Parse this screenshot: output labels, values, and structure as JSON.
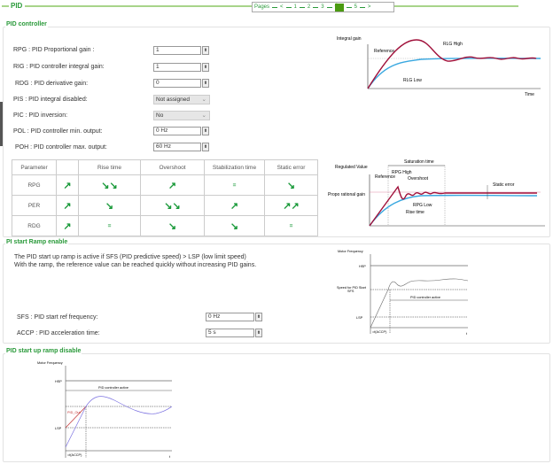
{
  "header": {
    "title": "PID",
    "pager": {
      "label": "Pages",
      "prev": "<",
      "next": ">",
      "pages": [
        "1",
        "2",
        "3",
        "4",
        "5"
      ],
      "current": "4"
    }
  },
  "pid_controller": {
    "title": "PID controller",
    "fields": [
      {
        "label": "RPG : PID Proportional gain :",
        "value": "1",
        "type": "spin"
      },
      {
        "label": "RIG : PID controller integral gain:",
        "value": "1",
        "type": "spin"
      },
      {
        "label": "RDG : PID derivative gain:",
        "value": "0",
        "type": "spin"
      },
      {
        "label": "PIS : PID integral disabled:",
        "value": "Not assigned",
        "type": "select"
      },
      {
        "label": "PIC : PID inversion:",
        "value": "No",
        "type": "select"
      },
      {
        "label": "POL : PID controller min. output:",
        "value": "0 Hz",
        "type": "spin"
      },
      {
        "label": "POH : PID controller max. output:",
        "value": "60 Hz",
        "type": "spin"
      }
    ],
    "table": {
      "headers": [
        "Parameter",
        "",
        "Rise time",
        "Overshoot",
        "Stabilization time",
        "Static error"
      ],
      "rows": [
        {
          "param": "RPG",
          "cells": [
            "↗",
            "↘↘",
            "↗",
            "=",
            "↘"
          ]
        },
        {
          "param": "PER",
          "cells": [
            "↗",
            "↘",
            "↘↘",
            "↗",
            "↗↗"
          ]
        },
        {
          "param": "RDG",
          "cells": [
            "↗",
            "=",
            "↘",
            "↘",
            "="
          ]
        }
      ]
    },
    "chart_integral": {
      "ylabel": "Integral gain",
      "xlabel": "Time",
      "reference": "Reference",
      "high": "RLG High",
      "low": "RLG Low"
    },
    "chart_proportional": {
      "ylabel1": "Regulated Value",
      "ylabel2": "Propo rational gain",
      "saturation": "Saturation time",
      "reference": "Reference",
      "high": "RPG High",
      "overshoot": "Overshoot",
      "low": "RPG Low",
      "rise": "Rise time",
      "static": "Static error"
    },
    "colors": {
      "high": "#a0103a",
      "low": "#3aa8e0",
      "accent": "#2a9a3a"
    }
  },
  "ramp_enable": {
    "title": "PI start Ramp enable",
    "text1": "The PID start up ramp is active if SFS (PID predictive speed) > LSP (low limit speed)",
    "text2": "With the ramp, the reference value can be reached quickly without increasing PID gains.",
    "fields": [
      {
        "label": "SFS : PID start ref frequency:",
        "value": "0 Hz"
      },
      {
        "label": "ACCP : PID acceleration time:",
        "value": "5 s"
      }
    ],
    "chart": {
      "ylabel": "Motor Frequency",
      "hsp": "HSP",
      "sfs1": "Speed for PID Start",
      "sfs2": "SFS",
      "lsp": "LSP",
      "active": "PID controller active",
      "accp": "=f(ACCP)",
      "t": "t"
    }
  },
  "ramp_disable": {
    "title": "PID start up ramp disable",
    "chart": {
      "ylabel": "Motor Frequency",
      "hsp": "HSP",
      "lsp": "LSP",
      "active": "PID controller active",
      "accp": "=f(ACCP)",
      "t": "t",
      "out": "PID_Out"
    }
  }
}
